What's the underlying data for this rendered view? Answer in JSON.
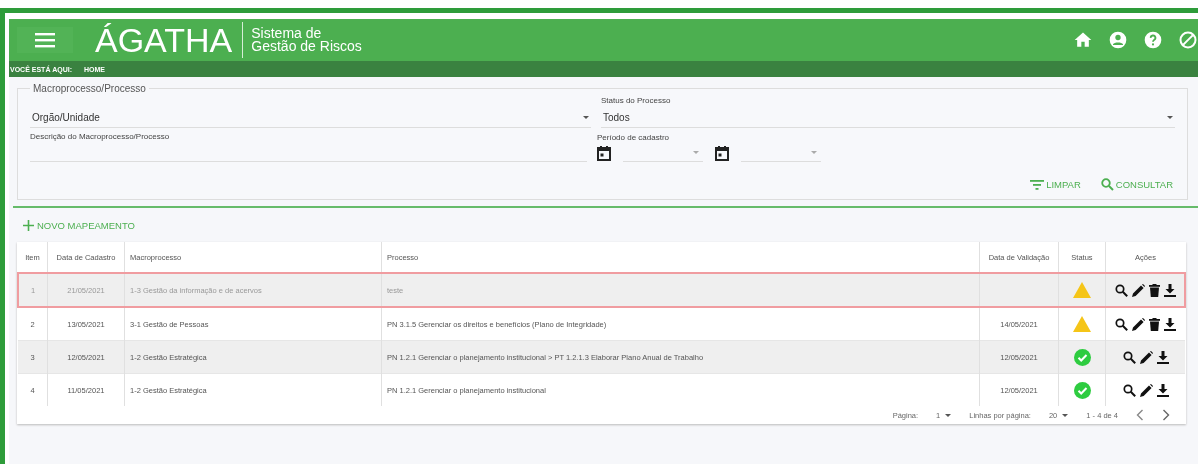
{
  "header": {
    "logo": "ÁGATHA",
    "subtitle_line1": "Sistema de",
    "subtitle_line2": "Gestão de Riscos"
  },
  "breadcrumb": {
    "label": "VOCÊ ESTÁ AQUI:",
    "current": "HOME"
  },
  "filters": {
    "legend": "Macroprocesso/Processo",
    "orgao": {
      "placeholder": "Orgão/Unidade"
    },
    "status": {
      "label": "Status do Processo",
      "value": "Todos"
    },
    "descricao": {
      "label": "Descrição do Macroprocesso/Processo"
    },
    "periodo": {
      "label": "Período de cadastro"
    },
    "buttons": [
      {
        "kind": "clear",
        "label": "LIMPAR"
      },
      {
        "kind": "search",
        "label": "CONSULTAR"
      }
    ]
  },
  "new_button": "NOVO MAPEAMENTO",
  "table": {
    "columns": [
      "Item",
      "Data de Cadastro",
      "Macroprocesso",
      "Processo",
      "Data de Validação",
      "Status",
      "Ações"
    ],
    "rows": [
      {
        "item": "1",
        "data_cadastro": "21/05/2021",
        "macroprocesso": "1-3 Gestão da informação e de acervos",
        "processo": "teste",
        "data_validacao": "",
        "status": {
          "kind": "warning"
        },
        "highlighted": true,
        "actions": [
          {
            "kind": "view"
          },
          {
            "kind": "edit"
          },
          {
            "kind": "delete"
          },
          {
            "kind": "download"
          }
        ]
      },
      {
        "item": "2",
        "data_cadastro": "13/05/2021",
        "macroprocesso": "3-1 Gestão de Pessoas",
        "processo": "PN 3.1.5 Gerenciar os direitos e benefícios (Plano de Integridade)",
        "data_validacao": "14/05/2021",
        "status": {
          "kind": "warning"
        },
        "highlighted": false,
        "actions": [
          {
            "kind": "view"
          },
          {
            "kind": "edit"
          },
          {
            "kind": "delete"
          },
          {
            "kind": "download"
          }
        ]
      },
      {
        "item": "3",
        "data_cadastro": "12/05/2021",
        "macroprocesso": "1-2 Gestão Estratégica",
        "processo": "PN 1.2.1 Gerenciar o planejamento institucional > PT 1.2.1.3 Elaborar Plano Anual de Trabalho",
        "data_validacao": "12/05/2021",
        "status": {
          "kind": "ok"
        },
        "highlighted": false,
        "actions": [
          {
            "kind": "view"
          },
          {
            "kind": "edit"
          },
          {
            "kind": "download"
          }
        ]
      },
      {
        "item": "4",
        "data_cadastro": "11/05/2021",
        "macroprocesso": "1-2 Gestão Estratégica",
        "processo": "PN 1.2.1 Gerenciar o planejamento institucional",
        "data_validacao": "12/05/2021",
        "status": {
          "kind": "ok"
        },
        "highlighted": false,
        "actions": [
          {
            "kind": "view"
          },
          {
            "kind": "edit"
          },
          {
            "kind": "download"
          }
        ]
      }
    ]
  },
  "pagination": {
    "page_label": "Página:",
    "page": "1",
    "rows_label": "Linhas por página:",
    "rows": "20",
    "range": "1 - 4 de 4"
  }
}
